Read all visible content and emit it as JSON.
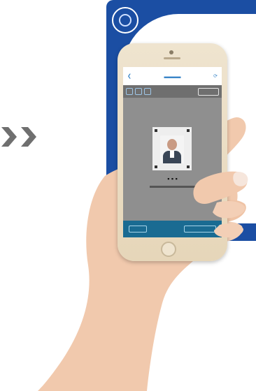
{
  "visual": {
    "arrow_color": "#6f6f6f",
    "card_color": "#1b4ea3",
    "phone_color": "#efe4cf",
    "screen_color": "#8f8f8f",
    "accent_blue": "#3b86c8",
    "bottom_bar_color": "#1a6b92",
    "skin_color": "#f1c9ad"
  },
  "icons": {
    "arrows": "chevron-right-icon",
    "card_emblem": "emblem-icon",
    "header_back": "back-icon",
    "header_right": "refresh-icon"
  }
}
